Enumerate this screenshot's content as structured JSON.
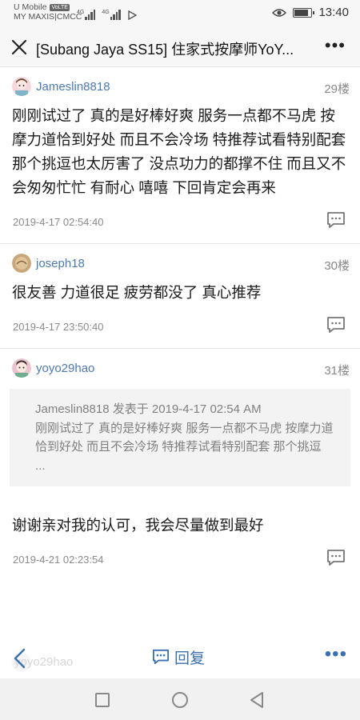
{
  "status_bar": {
    "carrier_1": "U Mobile",
    "carrier_1_tag": "VoLTE",
    "carrier_2": "MY MAXIS|CMCC",
    "network_1": "4G",
    "network_2": "4G",
    "time": "13:40",
    "battery_level": 0.85
  },
  "header": {
    "title": "[Subang Jaya SS15] 住家式按摩师YoY..."
  },
  "posts": [
    {
      "username": "Jameslin8818",
      "floor": "29楼",
      "content": "刚刚试过了 真的是好棒好爽 服务一点都不马虎 按摩力道恰到好处 而且不会冷场 特推荐试看特别配套 那个挑逗也太厉害了 没点功力的都撑不住 而且又不会匆匆忙忙 有耐心 嘻嘻 下回肯定会再来",
      "time": "2019-4-17 02:54:40"
    },
    {
      "username": "joseph18",
      "floor": "30楼",
      "content": "很友善 力道很足 疲劳都没了 真心推荐",
      "time": "2019-4-17 23:50:40"
    },
    {
      "username": "yoyo29hao",
      "floor": "31楼",
      "quote": {
        "header": "Jameslin8818 发表于 2019-4-17 02:54 AM",
        "text": "刚刚试过了 真的是好棒好爽 服务一点都不马虎 按摩力道恰到好处 而且不会冷场 特推荐试看特别配套 那个挑逗 ..."
      },
      "content": "谢谢亲对我的认可，我会尽量做到最好",
      "time": "2019-4-21 02:23:54"
    }
  ],
  "bottom_bar": {
    "next_username": "yoyo29hao",
    "reply_label": "回复"
  },
  "colors": {
    "accent": "#3a6fb0",
    "username": "#4a7ab8",
    "meta": "#8a8a8a"
  }
}
